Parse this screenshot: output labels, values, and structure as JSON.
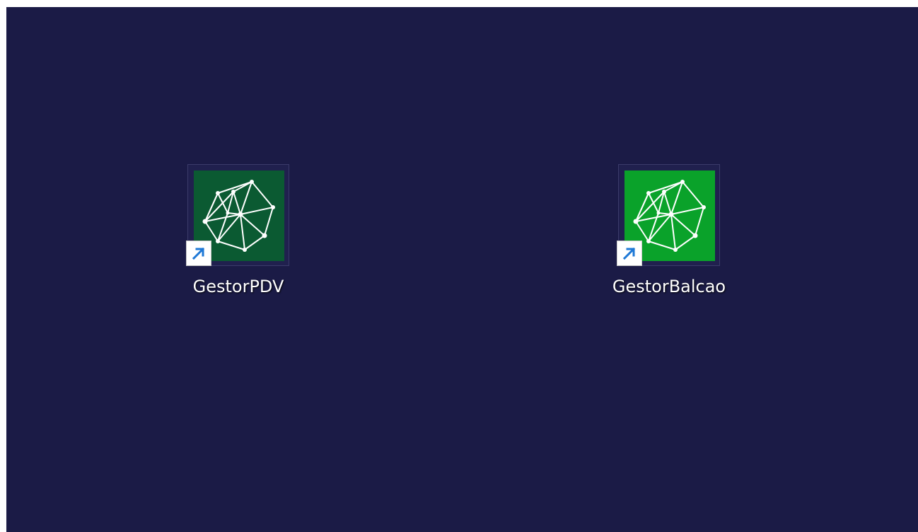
{
  "desktop": {
    "background": "#1b1b46",
    "shortcuts": [
      {
        "label": "GestorPDV",
        "icon": "network-graph-icon",
        "tile_color": "#0b5a32"
      },
      {
        "label": "GestorBalcao",
        "icon": "network-graph-icon",
        "tile_color": "#0aa22a"
      }
    ],
    "shortcut_overlay_icon": "shortcut-arrow-icon"
  }
}
